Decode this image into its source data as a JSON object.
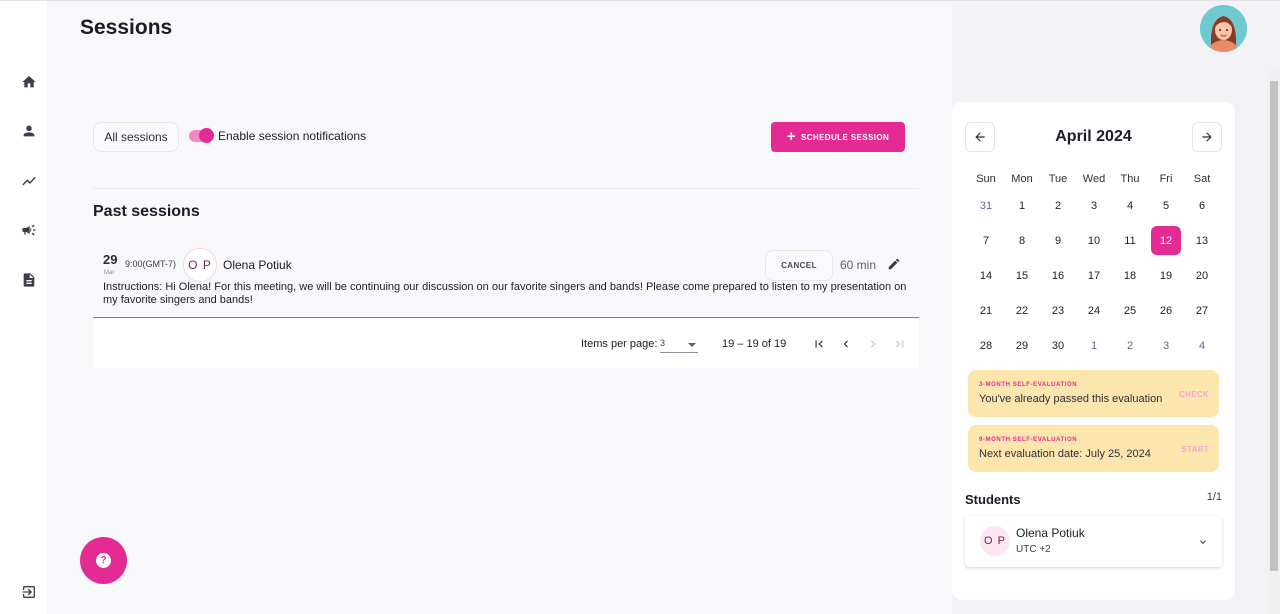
{
  "header": {
    "title": "Sessions"
  },
  "sidebar": {
    "items": [
      {
        "icon": "home-icon"
      },
      {
        "icon": "person-icon"
      },
      {
        "icon": "trending-icon"
      },
      {
        "icon": "megaphone-icon"
      },
      {
        "icon": "document-icon"
      }
    ],
    "logout_icon": "logout-icon"
  },
  "toolbar": {
    "filter_label": "All sessions",
    "notifications_label": "Enable session notifications",
    "notifications_enabled": true,
    "schedule_label": "SCHEDULE SESSION"
  },
  "past_sessions": {
    "title": "Past sessions",
    "items": [
      {
        "day": "29",
        "month": "Mar",
        "time": "9:00(GMT-7)",
        "initials": "O P",
        "name": "Olena Potiuk",
        "cancel_label": "CANCEL",
        "duration": "60 min",
        "instructions": "Instructions: Hi Olena! For this meeting, we will be continuing our discussion on our favorite singers and bands! Please come prepared to listen to my presentation on my favorite singers and bands!"
      }
    ]
  },
  "paginator": {
    "items_per_page_label": "Items per page:",
    "items_per_page_value": "3",
    "range": "19 – 19 of 19"
  },
  "calendar": {
    "month": "April 2024",
    "weekdays": [
      "Sun",
      "Mon",
      "Tue",
      "Wed",
      "Thu",
      "Fri",
      "Sat"
    ],
    "weeks": [
      [
        "31",
        "1",
        "2",
        "3",
        "4",
        "5",
        "6"
      ],
      [
        "7",
        "8",
        "9",
        "10",
        "11",
        "12",
        "13"
      ],
      [
        "14",
        "15",
        "16",
        "17",
        "18",
        "19",
        "20"
      ],
      [
        "21",
        "22",
        "23",
        "24",
        "25",
        "26",
        "27"
      ],
      [
        "28",
        "29",
        "30",
        "1",
        "2",
        "3",
        "4"
      ]
    ],
    "selected": "12"
  },
  "evaluations": [
    {
      "tag": "3-MONTH SELF-EVALUATION",
      "text": "You've already passed this evaluation",
      "action": "CHECK"
    },
    {
      "tag": "9-MONTH SELF-EVALUATION",
      "text": "Next evaluation date: July 25, 2024",
      "action": "START"
    }
  ],
  "students": {
    "title": "Students",
    "count": "1/1",
    "items": [
      {
        "initials": "O P",
        "name": "Olena Potiuk",
        "timezone": "UTC +2"
      }
    ]
  },
  "colors": {
    "accent": "#e42a93",
    "eval_bg": "#fde6ad"
  }
}
